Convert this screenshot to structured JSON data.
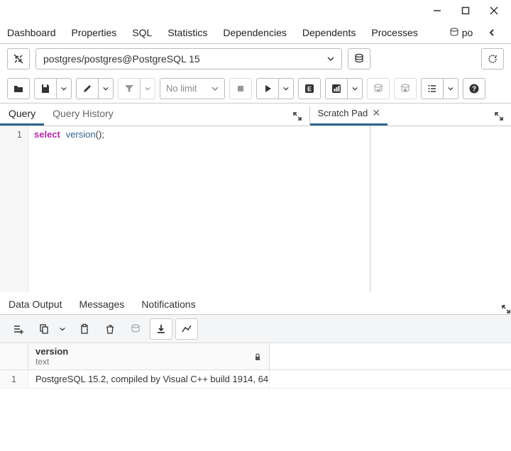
{
  "tabs": {
    "dashboard": "Dashboard",
    "properties": "Properties",
    "sql": "SQL",
    "statistics": "Statistics",
    "dependencies": "Dependencies",
    "dependents": "Dependents",
    "processes": "Processes",
    "overflow": "po"
  },
  "connection": "postgres/postgres@PostgreSQL 15",
  "limit": "No limit",
  "editor_tabs": {
    "query": "Query",
    "history": "Query History",
    "scratch": "Scratch Pad"
  },
  "sql": {
    "line1_num": "1",
    "line1_kw": "select",
    "line1_fn": "version",
    "line1_rest": "();"
  },
  "output_tabs": {
    "data": "Data Output",
    "messages": "Messages",
    "notifications": "Notifications"
  },
  "result": {
    "col_name": "version",
    "col_type": "text",
    "row_num": "1",
    "row_val": "PostgreSQL 15.2, compiled by Visual C++ build 1914, 64-..."
  }
}
